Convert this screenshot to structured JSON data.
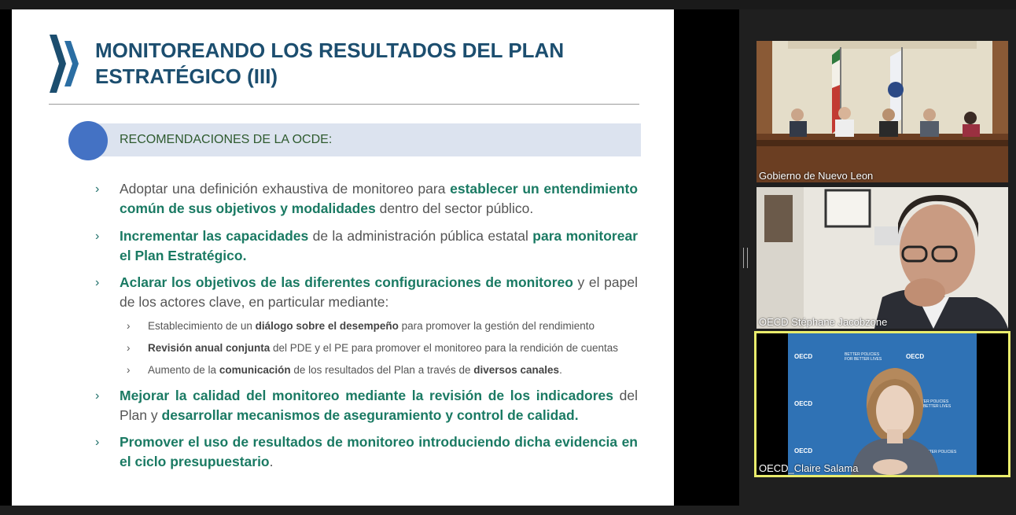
{
  "slide": {
    "title_line1": "MONITOREANDO LOS RESULTADOS DEL PLAN",
    "title_line2": "ESTRATÉGICO (III)",
    "recommendations_header": "RECOMENDACIONES DE LA OCDE:",
    "bullet_glyph": "›",
    "items": [
      {
        "p1": "Adoptar una definición exhaustiva de monitoreo para ",
        "b1": "establecer un entendimiento común de sus objetivos y modalidades",
        "p2": " dentro del sector público."
      },
      {
        "b1": "Incrementar las capacidades",
        "p1": " de la administración pública estatal ",
        "b2": "para monitorear el Plan Estratégico."
      },
      {
        "b1": "Aclarar los objetivos de las diferentes configuraciones de monitoreo",
        "p1": " y el papel de los actores clave, en particular mediante:"
      },
      {
        "b1": "Mejorar la calidad del monitoreo mediante la revisión de los indicadores",
        "p1": " del Plan y ",
        "b2": "desarrollar mecanismos de aseguramiento y control de calidad."
      },
      {
        "b1": "Promover el uso de resultados de monitoreo introduciendo dicha evidencia en el ciclo presupuestario",
        "p1": "."
      }
    ],
    "subitems": [
      {
        "p1": "Establecimiento de un ",
        "b1": "diálogo sobre el desempeño",
        "p2": " para promover la gestión del rendimiento"
      },
      {
        "b1": "Revisión anual conjunta",
        "p1": " del PDE y el PE para promover el monitoreo para la rendición de cuentas"
      },
      {
        "p1": "Aumento de la ",
        "b1": "comunicación",
        "p2": " de los resultados del Plan a través de ",
        "b2": "diversos canales",
        "p3": "."
      }
    ]
  },
  "participants": [
    {
      "name": "Gobierno de Nuevo Leon"
    },
    {
      "name": "OECD Stéphane Jacobzone"
    },
    {
      "name": "OECD_Claire Salama"
    }
  ],
  "backdrop": {
    "brand": "OECD",
    "tagline_1": "BETTER POLICIES",
    "tagline_2": "FOR BETTER LIVES"
  },
  "colors": {
    "title": "#1c4e6f",
    "emphasis": "#1a7a63",
    "active_speaker": "#e9ec6c",
    "backdrop": "#2f72b5"
  }
}
